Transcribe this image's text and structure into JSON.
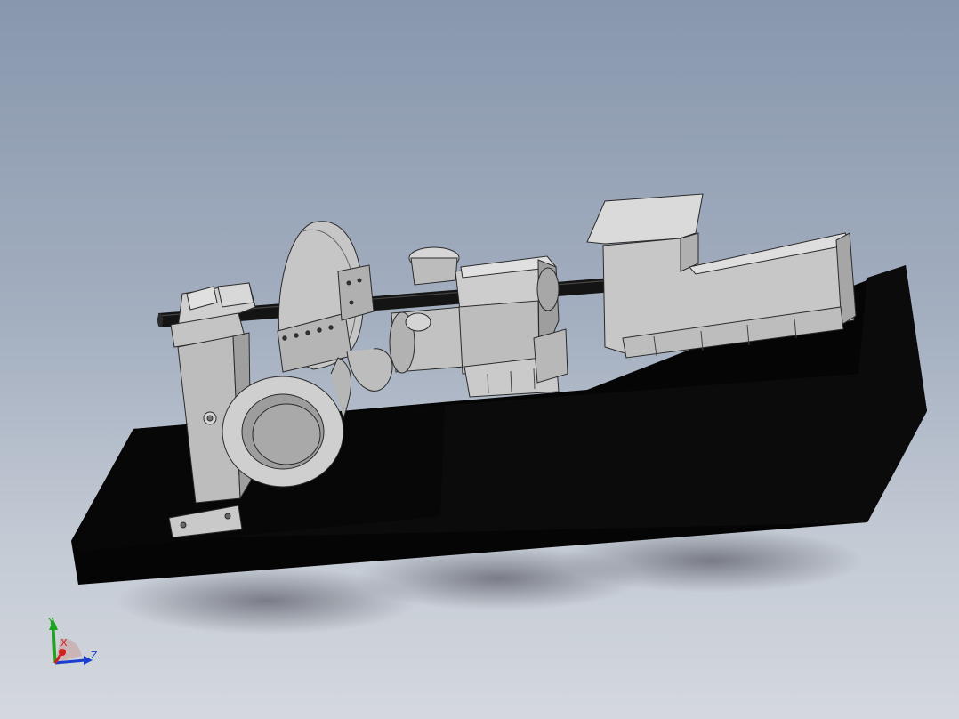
{
  "triad": {
    "y_label": "Y",
    "x_label": "X",
    "z_label": "Z",
    "colors": {
      "y": "#1aa51a",
      "x": "#d02020",
      "z": "#1a3fd0"
    }
  },
  "scene": {
    "base_color": "#050505",
    "part_color": "#bdbdbd",
    "part_shade": "#9c9c9c",
    "part_light": "#dedede",
    "shaft_color": "#111111",
    "edge_color": "#2a2a2a",
    "components": [
      "bearing-housing",
      "pump-casing",
      "shaft",
      "reducer",
      "motor"
    ]
  }
}
